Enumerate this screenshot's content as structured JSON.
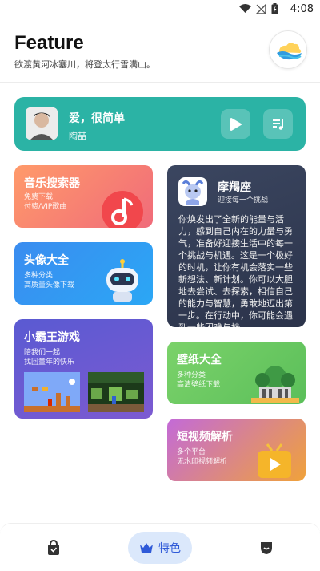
{
  "status_bar": {
    "time": "4:08",
    "icons": [
      "wifi-icon",
      "signal-off-icon",
      "battery-icon"
    ]
  },
  "header": {
    "title": "Feature",
    "subtitle": "欲渡黄河冰塞川，将登太行雪满山。"
  },
  "music_player": {
    "song": "爱，很简单",
    "artist": "陶喆",
    "play_icon": "play-icon",
    "playlist_icon": "playlist-icon"
  },
  "cards": {
    "music_search": {
      "title": "音乐搜索器",
      "line1": "免费下载",
      "line2": "付费/VIP歌曲"
    },
    "avatar": {
      "title": "头像大全",
      "line1": "多种分类",
      "line2": "高质量头像下载"
    },
    "game": {
      "title": "小霸王游戏",
      "line1": "陪我们一起",
      "line2": "找回童年的快乐"
    },
    "horoscope": {
      "title": "摩羯座",
      "subtitle": "迎接每一个挑战",
      "text": "你焕发出了全新的能量与活力，感到自己内在的力量与勇气，准备好迎接生活中的每一个挑战与机遇。这是一个极好的时机，让你有机会落实一些新想法、新计划。你可以大胆地去尝试、去探索，相信自己的能力与智慧，勇敢地迈出第一步。在行动中，你可能会遇到一些困难与挫..."
    },
    "wallpaper": {
      "title": "壁纸大全",
      "line1": "多种分类",
      "line2": "高清壁纸下载"
    },
    "short_video": {
      "title": "短视频解析",
      "line1": "多个平台",
      "line2": "无水印视频解析"
    }
  },
  "bottom_nav": {
    "left_icon": "bag-icon",
    "active_label": "特色",
    "active_icon": "crown-icon",
    "right_icon": "shield-icon"
  },
  "colors": {
    "teal": "#2bb3a5",
    "nav_active_bg": "#dbe8fb",
    "nav_active_text": "#2f5ad8"
  }
}
